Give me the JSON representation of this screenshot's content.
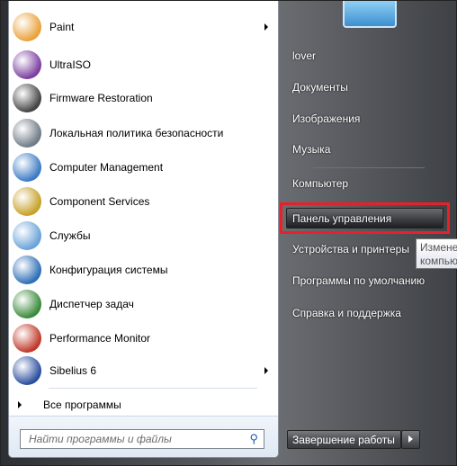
{
  "programs": [
    {
      "label": "Paint",
      "icon": "paint-icon",
      "color": "#e9a23b",
      "arrow": true
    },
    {
      "label": "UltraISO",
      "icon": "disc-icon",
      "color": "#7b3fa0",
      "arrow": false
    },
    {
      "label": "Firmware Restoration",
      "icon": "firmware-icon",
      "color": "#444444",
      "arrow": false
    },
    {
      "label": "Локальная политика безопасности",
      "icon": "security-policy-icon",
      "color": "#6f7b86",
      "arrow": false
    },
    {
      "label": "Computer Management",
      "icon": "computer-management-icon",
      "color": "#3c7bc4",
      "arrow": false
    },
    {
      "label": "Component Services",
      "icon": "component-services-icon",
      "color": "#c7a12a",
      "arrow": false
    },
    {
      "label": "Службы",
      "icon": "services-gear-icon",
      "color": "#6aa3d8",
      "arrow": false
    },
    {
      "label": "Конфигурация системы",
      "icon": "system-config-icon",
      "color": "#2e6fb7",
      "arrow": false
    },
    {
      "label": "Диспетчер задач",
      "icon": "task-manager-icon",
      "color": "#3a8a3a",
      "arrow": false
    },
    {
      "label": "Performance Monitor",
      "icon": "performance-monitor-icon",
      "color": "#c0392b",
      "arrow": false
    },
    {
      "label": "Sibelius 6",
      "icon": "sibelius-icon",
      "color": "#2b4f9e",
      "arrow": true
    }
  ],
  "all_programs": "Все программы",
  "search_placeholder": "Найти программы и файлы",
  "right": [
    "lover",
    "Документы",
    "Изображения",
    "Музыка",
    "Компьютер",
    "Панель управления",
    "Устройства и принтеры",
    "Программы по умолчанию",
    "Справка и поддержка"
  ],
  "tooltip": "Изменение компьютера",
  "shutdown": "Завершение работы",
  "highlight_color": "#e8202a"
}
